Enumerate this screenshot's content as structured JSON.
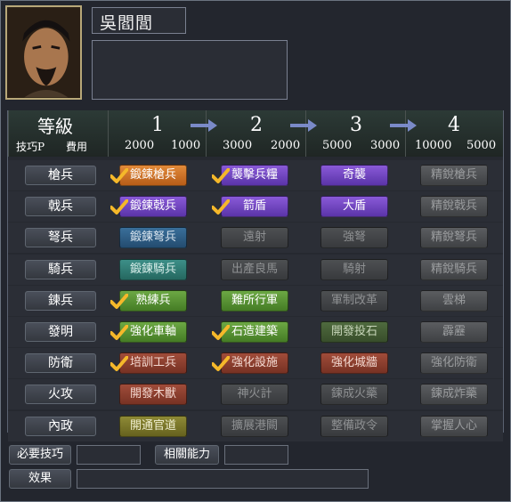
{
  "officer": {
    "name": "吳閻閭",
    "description": ""
  },
  "header": {
    "title": "等級",
    "skill_points_label": "技巧P",
    "cost_label": "費用",
    "stages": [
      {
        "num": "1",
        "skill_points": "2000",
        "cost": "1000"
      },
      {
        "num": "2",
        "skill_points": "3000",
        "cost": "2000"
      },
      {
        "num": "3",
        "skill_points": "5000",
        "cost": "3000"
      },
      {
        "num": "4",
        "skill_points": "10000",
        "cost": "5000"
      }
    ]
  },
  "rows": [
    {
      "label": "槍兵",
      "techs": [
        {
          "name": "鍛鍊槍兵",
          "checked": true,
          "color": "c-orange"
        },
        {
          "name": "襲擊兵糧",
          "checked": true,
          "color": "c-purple"
        },
        {
          "name": "奇襲",
          "checked": false,
          "color": "c-purple"
        },
        {
          "name": "精銳槍兵",
          "checked": false,
          "color": "c-gray"
        }
      ]
    },
    {
      "label": "戟兵",
      "techs": [
        {
          "name": "鍛鍊戟兵",
          "checked": true,
          "color": "c-purple"
        },
        {
          "name": "箭盾",
          "checked": true,
          "color": "c-purple"
        },
        {
          "name": "大盾",
          "checked": false,
          "color": "c-purple"
        },
        {
          "name": "精銳戟兵",
          "checked": false,
          "color": "c-gray"
        }
      ]
    },
    {
      "label": "弩兵",
      "techs": [
        {
          "name": "鍛鍊弩兵",
          "checked": false,
          "color": "c-blue"
        },
        {
          "name": "遠射",
          "checked": false,
          "color": "c-gray2"
        },
        {
          "name": "強弩",
          "checked": false,
          "color": "c-gray2"
        },
        {
          "name": "精銳弩兵",
          "checked": false,
          "color": "c-gray"
        }
      ]
    },
    {
      "label": "騎兵",
      "techs": [
        {
          "name": "鍛鍊騎兵",
          "checked": false,
          "color": "c-teal"
        },
        {
          "name": "出產良馬",
          "checked": false,
          "color": "c-gray2"
        },
        {
          "name": "騎射",
          "checked": false,
          "color": "c-gray2"
        },
        {
          "name": "精銳騎兵",
          "checked": false,
          "color": "c-gray"
        }
      ]
    },
    {
      "label": "鍊兵",
      "techs": [
        {
          "name": "熟練兵",
          "checked": true,
          "color": "c-green"
        },
        {
          "name": "難所行軍",
          "checked": false,
          "color": "c-green"
        },
        {
          "name": "軍制改革",
          "checked": false,
          "color": "c-gray2"
        },
        {
          "name": "雲梯",
          "checked": false,
          "color": "c-gray"
        }
      ]
    },
    {
      "label": "發明",
      "techs": [
        {
          "name": "強化車軸",
          "checked": true,
          "color": "c-green"
        },
        {
          "name": "石造建築",
          "checked": true,
          "color": "c-green"
        },
        {
          "name": "開發投石",
          "checked": false,
          "color": "c-green-dim"
        },
        {
          "name": "霹靂",
          "checked": false,
          "color": "c-gray"
        }
      ]
    },
    {
      "label": "防衛",
      "techs": [
        {
          "name": "培訓工兵",
          "checked": true,
          "color": "c-red"
        },
        {
          "name": "強化設施",
          "checked": true,
          "color": "c-red"
        },
        {
          "name": "強化城牆",
          "checked": false,
          "color": "c-red"
        },
        {
          "name": "強化防衛",
          "checked": false,
          "color": "c-gray"
        }
      ]
    },
    {
      "label": "火攻",
      "techs": [
        {
          "name": "開發木獸",
          "checked": false,
          "color": "c-red"
        },
        {
          "name": "神火計",
          "checked": false,
          "color": "c-gray2"
        },
        {
          "name": "鍊成火藥",
          "checked": false,
          "color": "c-gray2"
        },
        {
          "name": "鍊成炸藥",
          "checked": false,
          "color": "c-gray"
        }
      ]
    },
    {
      "label": "內政",
      "techs": [
        {
          "name": "開通官道",
          "checked": false,
          "color": "c-olive"
        },
        {
          "name": "擴展港闕",
          "checked": false,
          "color": "c-gray2"
        },
        {
          "name": "整備政令",
          "checked": false,
          "color": "c-gray2"
        },
        {
          "name": "掌握人心",
          "checked": false,
          "color": "c-gray"
        }
      ]
    }
  ],
  "footer": {
    "required_skill_label": "必要技巧",
    "required_skill_value": "",
    "related_ability_label": "相關能力",
    "related_ability_value": "",
    "effect_label": "效果",
    "effect_value": ""
  }
}
